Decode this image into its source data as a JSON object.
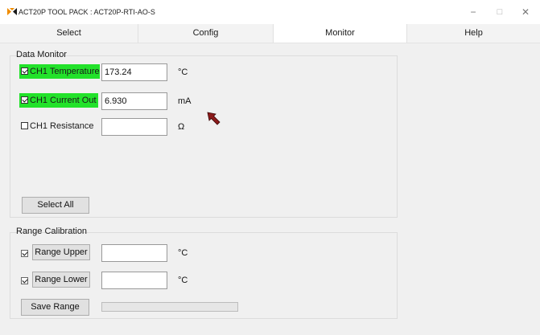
{
  "window": {
    "title": "ACT20P TOOL PACK : ACT20P-RTI-AO-S",
    "controls": {
      "minimize": "−",
      "maximize": "□",
      "close": "✕"
    }
  },
  "tabs": [
    {
      "label": "Select",
      "active": false
    },
    {
      "label": "Config",
      "active": false
    },
    {
      "label": "Monitor",
      "active": true
    },
    {
      "label": "Help",
      "active": false
    }
  ],
  "data_monitor": {
    "title": "Data Monitor",
    "channels": [
      {
        "label": "CH1 Temperature",
        "checked": true,
        "highlighted": true,
        "value": "173.24",
        "unit": "°C"
      },
      {
        "label": "CH1 Current Out",
        "checked": true,
        "highlighted": true,
        "value": "6.930",
        "unit": "mA"
      },
      {
        "label": "CH1 Resistance",
        "checked": false,
        "highlighted": false,
        "value": "",
        "unit": "Ω"
      }
    ],
    "select_all_label": "Select All"
  },
  "range_calibration": {
    "title": "Range Calibration",
    "upper": {
      "label": "Range Upper",
      "checked": true,
      "value": "",
      "unit": "°C"
    },
    "lower": {
      "label": "Range Lower",
      "checked": true,
      "value": "",
      "unit": "°C"
    },
    "save_label": "Save Range",
    "progress": 0
  },
  "colors": {
    "highlight": "#22e22a",
    "cursor": "#8b1a1a"
  }
}
